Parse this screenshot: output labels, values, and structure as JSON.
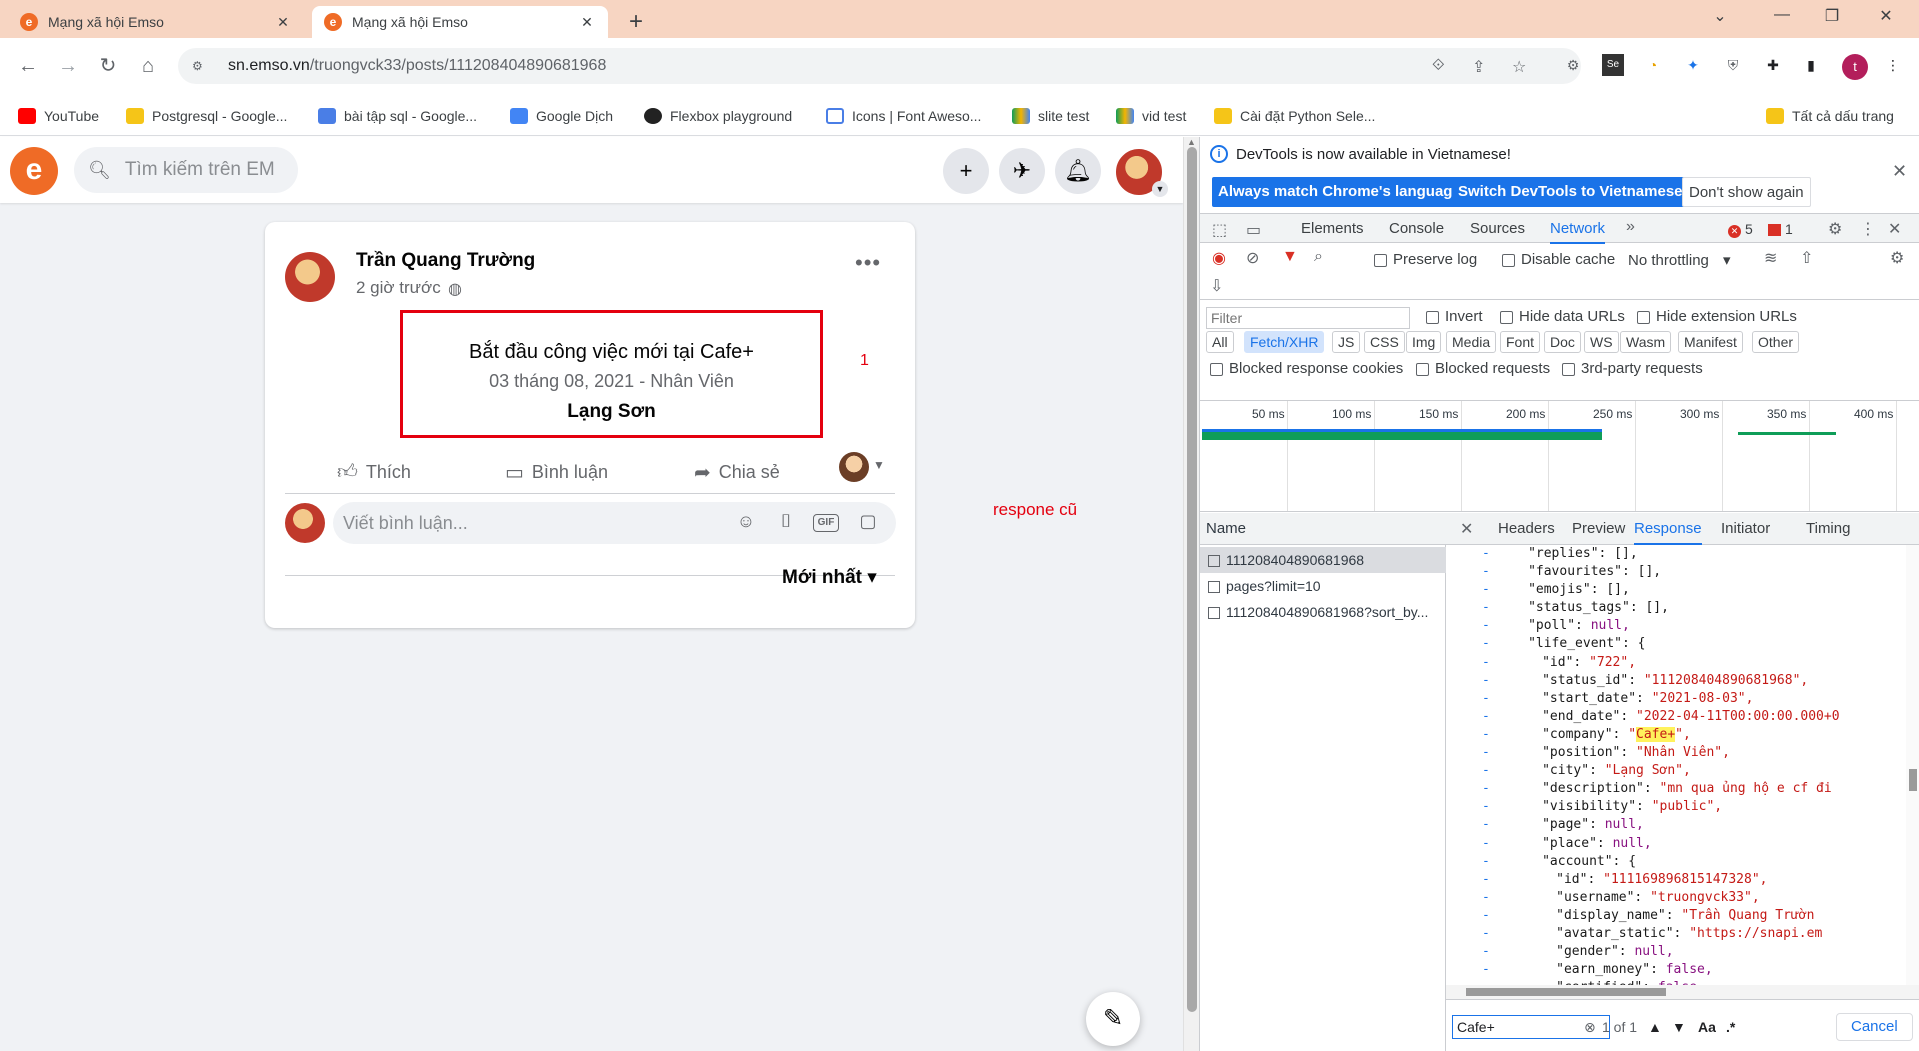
{
  "browser": {
    "tabs": [
      {
        "title": "Mạng xã hội Emso",
        "active": false
      },
      {
        "title": "Mạng xã hội Emso",
        "active": true
      }
    ],
    "url_host": "sn.emso.vn",
    "url_path": "/truongvck33/posts/111208404890681968",
    "profile_initial": "t",
    "bookmarks": [
      {
        "label": "YouTube",
        "icon": "youtube-icon"
      },
      {
        "label": "Postgresql - Google...",
        "icon": "folder-icon"
      },
      {
        "label": "bài tập sql - Google...",
        "icon": "docs-icon"
      },
      {
        "label": "Google Dịch",
        "icon": "translate-icon"
      },
      {
        "label": "Flexbox playground",
        "icon": "codepen-icon"
      },
      {
        "label": "Icons | Font Aweso...",
        "icon": "flag-icon"
      },
      {
        "label": "slite test",
        "icon": "drive-icon"
      },
      {
        "label": "vid test",
        "icon": "drive-icon"
      },
      {
        "label": "Cài đặt Python Sele...",
        "icon": "folder-icon"
      }
    ],
    "all_bookmarks": "Tất cả dấu trang"
  },
  "emso": {
    "search_placeholder": "Tìm kiếm trên EM",
    "post": {
      "author": "Trần Quang Trường",
      "time": "2 giờ trước",
      "life_event_title": "Bắt đầu công việc mới tại Cafe+",
      "life_event_sub": "03 tháng 08, 2021 - Nhân Viên",
      "life_event_city": "Lạng Sơn",
      "like": "Thích",
      "comment": "Bình luận",
      "share": "Chia sẻ",
      "comment_placeholder": "Viết bình luận...",
      "sort": "Mới nhất"
    },
    "annotation_1": "1",
    "annotation_old": "respone cũ"
  },
  "devtools": {
    "info_text": "DevTools is now available in Vietnamese!",
    "btn_match": "Always match Chrome's language",
    "btn_switch": "Switch DevTools to Vietnamese",
    "btn_dont_show": "Don't show again",
    "tabs": [
      "Elements",
      "Console",
      "Sources",
      "Network"
    ],
    "active_tab": "Network",
    "errors": "5",
    "issues": "1",
    "preserve_log": "Preserve log",
    "disable_cache": "Disable cache",
    "throttling": "No throttling",
    "filter_placeholder": "Filter",
    "invert": "Invert",
    "hide_data_urls": "Hide data URLs",
    "hide_ext_urls": "Hide extension URLs",
    "types": [
      "All",
      "Fetch/XHR",
      "JS",
      "CSS",
      "Img",
      "Media",
      "Font",
      "Doc",
      "WS",
      "Wasm",
      "Manifest",
      "Other"
    ],
    "active_type": "Fetch/XHR",
    "blocked_cookies": "Blocked response cookies",
    "blocked_requests": "Blocked requests",
    "third_party": "3rd-party requests",
    "timeline_ticks": [
      "50 ms",
      "100 ms",
      "150 ms",
      "200 ms",
      "250 ms",
      "300 ms",
      "350 ms",
      "400 ms"
    ],
    "name_header": "Name",
    "requests": [
      "111208404890681968",
      "pages?limit=10",
      "111208404890681968?sort_by..."
    ],
    "detail_tabs": [
      "Headers",
      "Preview",
      "Response",
      "Initiator",
      "Timing"
    ],
    "active_detail_tab": "Response",
    "response_lines": [
      {
        "indent": 4,
        "key": "replies",
        "val": "[],",
        "type": "plain"
      },
      {
        "indent": 4,
        "key": "favourites",
        "val": "[],",
        "type": "plain"
      },
      {
        "indent": 4,
        "key": "emojis",
        "val": "[],",
        "type": "plain"
      },
      {
        "indent": 4,
        "key": "status_tags",
        "val": "[],",
        "type": "plain"
      },
      {
        "indent": 4,
        "key": "poll",
        "val": "null,",
        "type": "kw"
      },
      {
        "indent": 4,
        "key": "life_event",
        "val": "{",
        "type": "plain"
      },
      {
        "indent": 6,
        "key": "id",
        "val": "\"722\",",
        "type": "str"
      },
      {
        "indent": 6,
        "key": "status_id",
        "val": "\"111208404890681968\",",
        "type": "str"
      },
      {
        "indent": 6,
        "key": "start_date",
        "val": "\"2021-08-03\",",
        "type": "str"
      },
      {
        "indent": 6,
        "key": "end_date",
        "val": "\"2022-04-11T00:00:00.000+0",
        "type": "str"
      },
      {
        "indent": 6,
        "key": "company",
        "val": "Cafe+",
        "type": "hl"
      },
      {
        "indent": 6,
        "key": "position",
        "val": "\"Nhân Viên\",",
        "type": "str"
      },
      {
        "indent": 6,
        "key": "city",
        "val": "\"Lạng Sơn\",",
        "type": "str"
      },
      {
        "indent": 6,
        "key": "description",
        "val": "\"mn qua ủng hộ e cf đi",
        "type": "str"
      },
      {
        "indent": 6,
        "key": "visibility",
        "val": "\"public\",",
        "type": "str"
      },
      {
        "indent": 6,
        "key": "page",
        "val": "null,",
        "type": "kw"
      },
      {
        "indent": 6,
        "key": "place",
        "val": "null,",
        "type": "kw"
      },
      {
        "indent": 6,
        "key": "account",
        "val": "{",
        "type": "plain"
      },
      {
        "indent": 8,
        "key": "id",
        "val": "\"111169896815147328\",",
        "type": "str"
      },
      {
        "indent": 8,
        "key": "username",
        "val": "\"truongvck33\",",
        "type": "str"
      },
      {
        "indent": 8,
        "key": "display_name",
        "val": "\"Trần Quang Trườn",
        "type": "str"
      },
      {
        "indent": 8,
        "key": "avatar_static",
        "val": "\"https://snapi.em",
        "type": "str"
      },
      {
        "indent": 8,
        "key": "gender",
        "val": "null,",
        "type": "kw"
      },
      {
        "indent": 8,
        "key": "earn_money",
        "val": "false,",
        "type": "kw"
      },
      {
        "indent": 8,
        "key": "certified",
        "val": "false,",
        "type": "kw"
      }
    ],
    "search_value": "Cafe+",
    "search_count": "1 of 1",
    "match_case": "Aa",
    "regex": ".*",
    "cancel": "Cancel"
  }
}
